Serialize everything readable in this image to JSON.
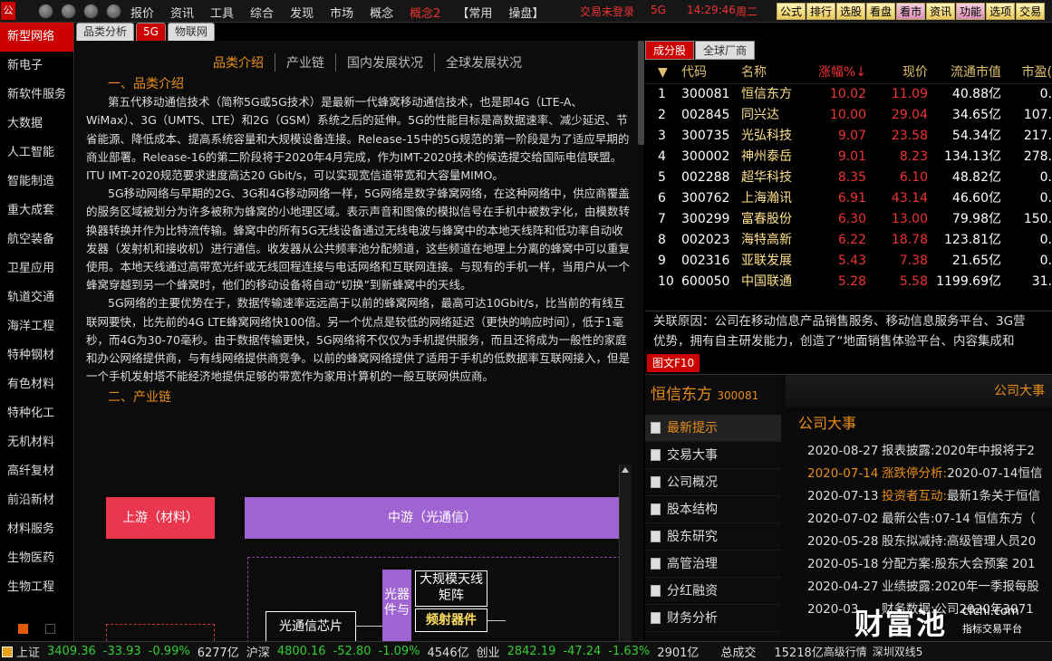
{
  "topbar": {
    "logo": "公",
    "menu": [
      "报价",
      "资讯",
      "工具",
      "综合",
      "发现",
      "市场",
      "概念",
      "概念2",
      "【常用",
      "操盘】"
    ],
    "status": {
      "login": "交易未登录",
      "net": "5G",
      "time": "14:29:46",
      "weekday": "周二"
    },
    "funcs": [
      "公式",
      "排行",
      "选股",
      "看盘",
      "看市",
      "资讯",
      "功能",
      "选项",
      "交易"
    ]
  },
  "sidebar": {
    "items": [
      "新型网络",
      "新电子",
      "新软件服务",
      "大数据",
      "人工智能",
      "智能制造",
      "重大成套",
      "航空装备",
      "卫星应用",
      "轨道交通",
      "海洋工程",
      "特种钢材",
      "有色材料",
      "特种化工",
      "无机材料",
      "高纤复材",
      "前沿新材",
      "材料服务",
      "生物医药",
      "生物工程"
    ]
  },
  "tabs": [
    "品类分析",
    "5G",
    "物联网"
  ],
  "center": {
    "sectabs": [
      "品类介绍",
      "产业链",
      "国内发展状况",
      "全球发展状况"
    ],
    "h1": "一、品类介绍",
    "p1": "第五代移动通信技术（简称5G或5G技术）是最新一代蜂窝移动通信技术，也是即4G（LTE-A、WiMax）、3G（UMTS、LTE）和2G（GSM）系统之后的延伸。5G的性能目标是高数据速率、减少延迟、节省能源、降低成本、提高系统容量和大规模设备连接。Release-15中的5G规范的第一阶段是为了适应早期的商业部署。Release-16的第二阶段将于2020年4月完成，作为IMT-2020技术的候选提交给国际电信联盟。ITU IMT-2020规范要求速度高达20 Gbit/s，可以实现宽信道带宽和大容量MIMO。",
    "p2": "5G移动网络与早期的2G、3G和4G移动网络一样，5G网络是数字蜂窝网络，在这种网络中，供应商覆盖的服务区域被划分为许多被称为蜂窝的小地理区域。表示声音和图像的模拟信号在手机中被数字化，由模数转换器转换并作为比特流传输。蜂窝中的所有5G无线设备通过无线电波与蜂窝中的本地天线阵和低功率自动收发器（发射机和接收机）进行通信。收发器从公共频率池分配频道，这些频道在地理上分离的蜂窝中可以重复使用。本地天线通过高带宽光纤或无线回程连接与电话网络和互联网连接。与现有的手机一样，当用户从一个蜂窝穿越到另一个蜂窝时，他们的移动设备将自动“切换”到新蜂窝中的天线。",
    "p3": "5G网络的主要优势在于，数据传输速率远远高于以前的蜂窝网络，最高可达10Gbit/s，比当前的有线互联网要快，比先前的4G LTE蜂窝网络快100倍。另一个优点是较低的网络延迟（更快的响应时间），低于1毫秒，而4G为30-70毫秒。由于数据传输更快，5G网络将不仅仅为手机提供服务，而且还将成为一般性的家庭和办公网络提供商，与有线网络提供商竞争。以前的蜂窝网络提供了适用于手机的低数据率互联网接入，但是一个手机发射塔不能经济地提供足够的带宽作为家用计算机的一般互联网供应商。",
    "h2": "二、产业链",
    "diagram": {
      "upstream": "上游（材料）",
      "midstream": "中游（光通信）",
      "vbar": "光器件与",
      "chip": "光通信芯片",
      "antenna": "大规模天线矩阵",
      "rf": "频射器件"
    }
  },
  "right": {
    "tabs": [
      "成分股",
      "全球厂商"
    ],
    "header": [
      "代码",
      "名称",
      "涨幅%↓",
      "现价",
      "流通市值",
      "市盈("
    ],
    "rows": [
      [
        "1",
        "300081",
        "恒信东方",
        "10.02",
        "11.09",
        "40.88亿",
        "0."
      ],
      [
        "2",
        "002845",
        "同兴达",
        "10.00",
        "29.04",
        "34.65亿",
        "107."
      ],
      [
        "3",
        "300735",
        "光弘科技",
        "9.07",
        "23.58",
        "54.34亿",
        "217."
      ],
      [
        "4",
        "300002",
        "神州泰岳",
        "9.01",
        "8.23",
        "134.13亿",
        "278."
      ],
      [
        "5",
        "002288",
        "超华科技",
        "8.35",
        "6.10",
        "48.82亿",
        "0."
      ],
      [
        "6",
        "300762",
        "上海瀚讯",
        "6.91",
        "43.14",
        "46.60亿",
        "0."
      ],
      [
        "7",
        "300299",
        "富春股份",
        "6.30",
        "13.00",
        "79.98亿",
        "150."
      ],
      [
        "8",
        "002023",
        "海特高新",
        "6.22",
        "18.78",
        "123.81亿",
        "0."
      ],
      [
        "9",
        "002316",
        "亚联发展",
        "5.43",
        "7.38",
        "21.65亿",
        "0."
      ],
      [
        "10",
        "600050",
        "中国联通",
        "5.28",
        "5.58",
        "1199.69亿",
        "31."
      ]
    ],
    "reason1": "关联原因：公司在移动信息产品销售服务、移动信息服务平台、3G营",
    "reason2": "优势，拥有自主研发能力，创造了“地面销售体验平台、内容集成和",
    "f10tab": "图文F10",
    "company": "恒信东方",
    "code": "300081",
    "f10items": [
      "最新提示",
      "交易大事",
      "公司概况",
      "股本结构",
      "股东研究",
      "高管治理",
      "分红融资",
      "财务分析"
    ],
    "f10hdr": "公司大事",
    "f10sec": "公司大事",
    "events": [
      {
        "d": "2020-08-27",
        "k": "",
        "t": "报表披露:2020年中报将于2"
      },
      {
        "d": "2020-07-14",
        "k": "涨跌停分析:",
        "t": "2020-07-14恒信"
      },
      {
        "d": "2020-07-13",
        "k": "投资者互动:",
        "t": "最新1条关于恒信"
      },
      {
        "d": "2020-07-02",
        "k": "",
        "t": "最新公告:07-14 恒信东方（"
      },
      {
        "d": "2020-05-28",
        "k": "",
        "t": "股东拟减持:高级管理人员20"
      },
      {
        "d": "2020-05-18",
        "k": "",
        "t": "分配方案:股东大会预案 201"
      },
      {
        "d": "2020-04-27",
        "k": "",
        "t": "业绩披露:2020年一季报每股"
      },
      {
        "d": "2020-03",
        "k": "",
        "t": "财务数据:公司2020年3071"
      }
    ]
  },
  "watermark": {
    "big": "财富池",
    "url": "cfchi.com",
    "sub": "指标交易平台"
  },
  "bottom": {
    "sh_label": "上证",
    "sh_val": "3409.36",
    "sh_chg": "-33.93",
    "sh_pct": "-0.99%",
    "sh_amt": "6277亿",
    "hs_label": "沪深",
    "hs_val": "4800.16",
    "hs_chg": "-52.80",
    "hs_pct": "-1.09%",
    "hs_amt": "4546亿",
    "cy_label": "创业",
    "cy_val": "2842.19",
    "cy_chg": "-47.24",
    "cy_pct": "-1.63%",
    "cy_amt": "2901亿",
    "total_label": "总成交",
    "total": "15218亿",
    "adv": "高级行情",
    "conn": "深圳双线5"
  }
}
